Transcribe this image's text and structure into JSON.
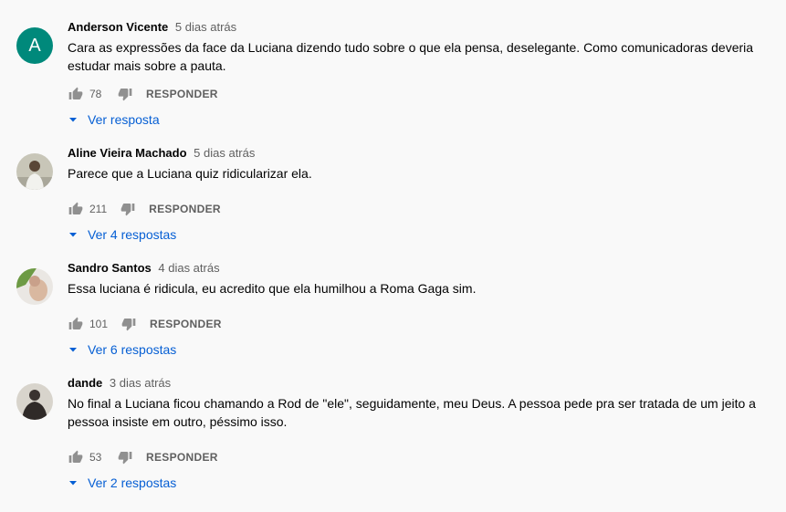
{
  "comments": [
    {
      "author": "Anderson Vicente",
      "time": "5 dias atrás",
      "avatar_letter": "A",
      "avatar_color": "#00897b",
      "text_lines": [
        "Cara as expressões da face da Luciana dizendo tudo sobre o que ela pensa, deselegante. Como comunicadoras deveria",
        "estudar mais sobre a pauta."
      ],
      "likes": "78",
      "reply_label": "RESPONDER",
      "view_replies": "Ver resposta"
    },
    {
      "author": "Aline Vieira Machado",
      "time": "5 dias atrás",
      "text_lines": [
        "Parece que a Luciana quiz ridicularizar ela."
      ],
      "likes": "211",
      "reply_label": "RESPONDER",
      "view_replies": "Ver 4 respostas"
    },
    {
      "author": "Sandro Santos",
      "time": "4 dias atrás",
      "text_lines": [
        "Essa luciana é ridicula, eu acredito que ela humilhou a Roma Gaga sim."
      ],
      "likes": "101",
      "reply_label": "RESPONDER",
      "view_replies": "Ver 6 respostas"
    },
    {
      "author": "dande",
      "time": "3 dias atrás",
      "text_lines": [
        "No final a Luciana ficou chamando a Rod de \"ele\", seguidamente, meu Deus. A pessoa pede pra ser tratada de um jeito a",
        "pessoa insiste em outro, péssimo isso."
      ],
      "likes": "53",
      "reply_label": "RESPONDER",
      "view_replies": "Ver 2 respostas"
    }
  ],
  "colors": {
    "link": "#065fd4",
    "secondary_text": "#606060",
    "background": "#f9f9f9"
  }
}
